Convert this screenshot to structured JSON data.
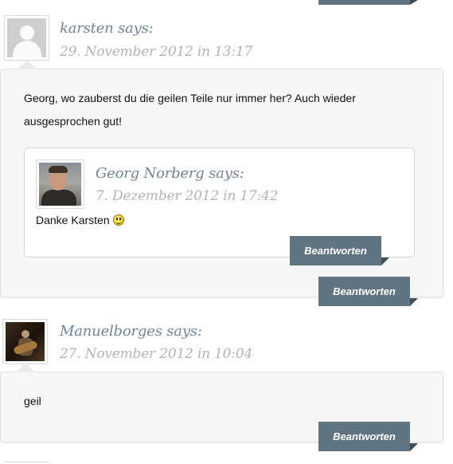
{
  "reply_label": "Beantworten",
  "colors": {
    "button": "#617482",
    "author": "#728396",
    "date": "#b3b3b3"
  },
  "comments": [
    {
      "author": "karsten says:",
      "date": "29. November 2012 in 13:17",
      "avatar": "default-avatar-icon",
      "text_lines": [
        "Georg, wo zauberst du die geilen Teile nur immer her? Auch wieder",
        "ausgesprochen gut!"
      ],
      "replies": [
        {
          "author": "Georg Norberg says:",
          "date": "7. Dezember 2012 in 17:42",
          "avatar": "photo-avatar",
          "text": "Danke Karsten",
          "emoji": "smiley-icon"
        }
      ]
    },
    {
      "author": "Manuelborges says:",
      "date": "27. November 2012 in 10:04",
      "avatar": "photo-avatar",
      "text_lines": [
        "geil"
      ]
    }
  ]
}
